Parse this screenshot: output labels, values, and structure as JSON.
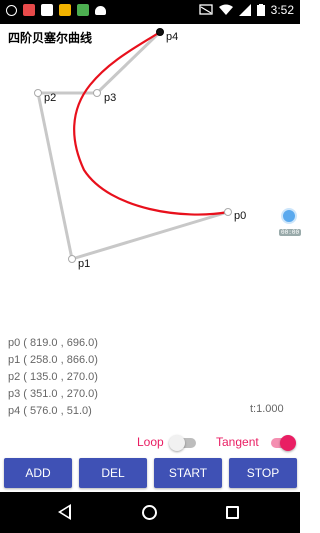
{
  "status_bar": {
    "time": "3:52",
    "left_icons": [
      "notification-icon",
      "app-icon-1",
      "app-icon-2",
      "app-icon-3",
      "app-icon-4",
      "android-icon"
    ],
    "right_icons": [
      "cast-icon",
      "wifi-icon",
      "signal-icon",
      "battery-icon"
    ]
  },
  "title": "四阶贝塞尔曲线",
  "points": {
    "p0": "p0",
    "p1": "p1",
    "p2": "p2",
    "p3": "p3",
    "p4": "p4"
  },
  "coords": [
    "p0 ( 819.0 , 696.0)",
    "p1 ( 258.0 , 866.0)",
    "p2 ( 135.0 , 270.0)",
    "p3 ( 351.0 , 270.0)",
    "p4 ( 576.0 , 51.0)"
  ],
  "t_value": "t:1.000",
  "toggles": {
    "loop_label": "Loop",
    "loop_on": false,
    "tangent_label": "Tangent",
    "tangent_on": true
  },
  "buttons": {
    "add": "ADD",
    "del": "DEL",
    "start": "START",
    "stop": "STOP"
  },
  "floating_label": "00:00",
  "colors": {
    "curve": "#e8101c",
    "control_lines": "#c8c8c8",
    "button_bg": "#3f51b5",
    "accent": "#e91e63"
  }
}
